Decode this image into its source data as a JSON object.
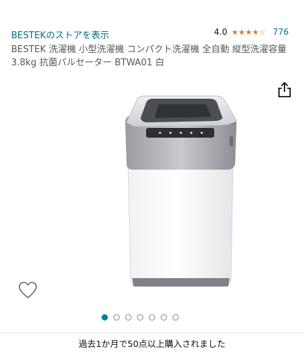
{
  "store": {
    "link_label": "BESTEKのストアを表示",
    "rating_value": "4.0",
    "stars": [
      "full",
      "full",
      "full",
      "full",
      "empty"
    ],
    "rating_count": "776"
  },
  "product": {
    "title": "BESTEK 洗濯機 小型洗濯機 コンパクト洗濯機 全自動 縦型洗濯容量 3.8kg 抗菌パルセーター BTWA01 白",
    "image_icon": "washing-machine-image"
  },
  "icons": {
    "share": "share-icon",
    "wishlist": "heart-icon"
  },
  "carousel": {
    "count": 7,
    "active_index": 0
  },
  "purchase_note": "過去1か月で50点以上購入されました",
  "colors": {
    "link": "#007185",
    "star": "#de7921",
    "active_dot": "#008296"
  }
}
